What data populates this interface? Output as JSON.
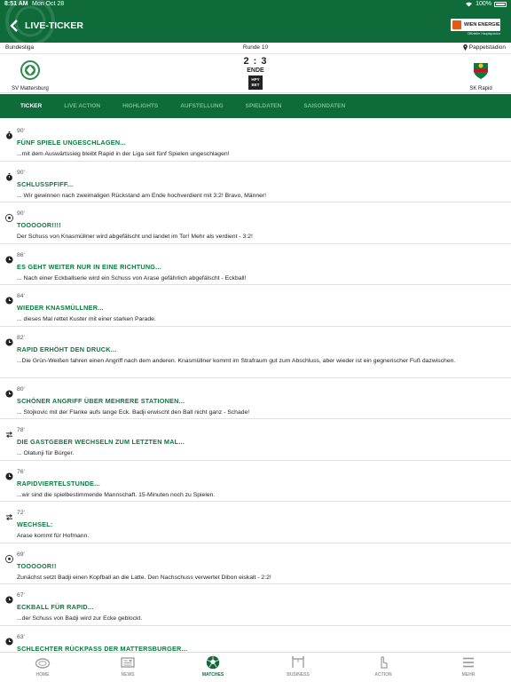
{
  "status_bar": {
    "time": "8:51 AM",
    "date": "Mon Oct 28",
    "battery": "100%"
  },
  "header": {
    "title": "LIVE-TICKER",
    "sponsor_name": "WIEN ENERGIE",
    "sponsor_sub": "Offizieller Hauptsponsor"
  },
  "match": {
    "league": "Bundesliga",
    "round": "Runde 10",
    "venue": "Pappelstadion",
    "home_team": "SV Mattersburg",
    "away_team": "SK Rapid",
    "score": "2 : 3",
    "status": "ENDE",
    "bet_logo": "HPY BET"
  },
  "tabs": [
    {
      "label": "TICKER",
      "active": true
    },
    {
      "label": "LIVE ACTION",
      "active": false
    },
    {
      "label": "HIGHLIGHTS",
      "active": false
    },
    {
      "label": "AUFSTELLUNG",
      "active": false
    },
    {
      "label": "SPIELDATEN",
      "active": false
    },
    {
      "label": "SAISONDATEN",
      "active": false
    }
  ],
  "ticker": [
    {
      "icon": "stopwatch-icon",
      "minute": "90'",
      "headline": "FÜNF SPIELE UNGESCHLAGEN...",
      "text": "...mit dem Auswärtssieg bleibt Rapid in der Liga seit fünf Spielen ungeschlagen!"
    },
    {
      "icon": "stopwatch-icon",
      "minute": "90'",
      "headline": "SCHLUSSPFIFF...",
      "text": "... Wir gewinnen nach zweimaligen Rückstand am Ende hochverdient mit 3:2! Bravo, Männer!"
    },
    {
      "icon": "football-icon",
      "minute": "90'",
      "headline": "TOOOOOR!!!!",
      "text": "Der Schuss von Knasmüllner wird abgefälscht und landet im Tor! Mehr als verdient - 3:2!"
    },
    {
      "icon": "clock-icon",
      "minute": "86'",
      "headline": "ES GEHT WEITER NUR IN EINE RICHTUNG...",
      "text": "... Nach einer Eckballserie wird ein Schuss von Arase gefährlich abgefälscht - Eckball!"
    },
    {
      "icon": "clock-icon",
      "minute": "84'",
      "headline": "WIEDER KNASMÜLLNER...",
      "text": "... dieses Mal rettet Kuster mit einer starken Parade."
    },
    {
      "icon": "clock-icon",
      "minute": "82'",
      "headline": "RAPID ERHÖHT DEN DRUCK...",
      "text": "...Die Grün-Weißen fahren einen Angriff nach dem anderen. Knasmüllner kommt im Strafraum gut zum Abschluss, aber wieder ist ein gegnerischer Fuß dazwischen."
    },
    {
      "icon": "clock-icon",
      "minute": "80'",
      "headline": "SCHÖNER ANGRIFF ÜBER MEHRERE STATIONEN...",
      "text": "... Stojkovic mit der Flanke aufs lange Eck. Badji erwischt den Ball nicht ganz - Schade!"
    },
    {
      "icon": "substitution-icon",
      "minute": "78'",
      "headline": "DIE GASTGEBER WECHSELN ZUM LETZTEN MAL...",
      "text": "... Olatunji für Bürger."
    },
    {
      "icon": "clock-icon",
      "minute": "76'",
      "headline": "RAPIDVIERTELSTUNDE...",
      "text": "...wir sind die spielbestimmende Mannschaft. 15-Minuten noch zu Spielen."
    },
    {
      "icon": "substitution-icon",
      "minute": "72'",
      "headline": "WECHSEL:",
      "text": "Arase kommt für Hofmann."
    },
    {
      "icon": "football-icon",
      "minute": "69'",
      "headline": "TOOOOOR!!",
      "text": "Zunächst setzt Badji einen Kopfball an die Latte. Den Nachschuss verwertet Dibon eiskalt - 2:2!"
    },
    {
      "icon": "clock-icon",
      "minute": "67'",
      "headline": "ECKBALL FÜR RAPID...",
      "text": "...der Schuss von Badji wird zur Ecke geblockt."
    },
    {
      "icon": "clock-icon",
      "minute": "63'",
      "headline": "SCHLECHTER RÜCKPASS DER MATTERSBURGER...",
      "text": ""
    }
  ],
  "bottom_nav": [
    {
      "label": "HOME",
      "icon": "stadium-icon",
      "active": false
    },
    {
      "label": "NEWS",
      "icon": "newspaper-icon",
      "active": false
    },
    {
      "label": "MATCHES",
      "icon": "football-icon",
      "active": true
    },
    {
      "label": "BUSINESS",
      "icon": "business-icon",
      "active": false
    },
    {
      "label": "ACTION",
      "icon": "hand-pointer-icon",
      "active": false
    },
    {
      "label": "MEHR",
      "icon": "menu-icon",
      "active": false
    }
  ],
  "colors": {
    "brand_green": "#0f6b3a",
    "headline_green": "#0d7a3e",
    "tab_inactive": "#6fbf8f"
  }
}
